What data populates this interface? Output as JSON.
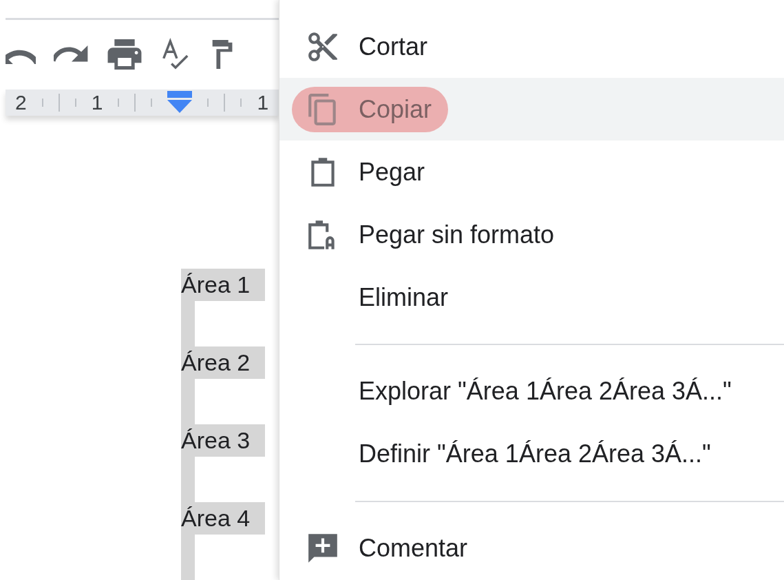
{
  "ruler": {
    "labels": [
      "2",
      "1",
      "1"
    ]
  },
  "document": {
    "lines": [
      "Área 1",
      "Área 2",
      "Área 3",
      "Área 4"
    ]
  },
  "context_menu": {
    "items": [
      {
        "kind": "cut",
        "label": "Cortar",
        "selected": false,
        "highlighted": false
      },
      {
        "kind": "copy",
        "label": "Copiar",
        "selected": true,
        "highlighted": true
      },
      {
        "kind": "paste",
        "label": "Pegar",
        "selected": false,
        "highlighted": false
      },
      {
        "kind": "pasteplain",
        "label": "Pegar sin formato",
        "selected": false,
        "highlighted": false
      },
      {
        "kind": "plain",
        "label": "Eliminar",
        "selected": false,
        "highlighted": false
      },
      {
        "kind": "divider"
      },
      {
        "kind": "plain",
        "label": "Explorar \"Área 1Área 2Área 3Á...\"",
        "selected": false,
        "highlighted": false
      },
      {
        "kind": "plain",
        "label": "Definir \"Área 1Área 2Área 3Á...\"",
        "selected": false,
        "highlighted": false
      },
      {
        "kind": "divider"
      },
      {
        "kind": "comment",
        "label": "Comentar",
        "selected": false,
        "highlighted": false
      }
    ]
  }
}
